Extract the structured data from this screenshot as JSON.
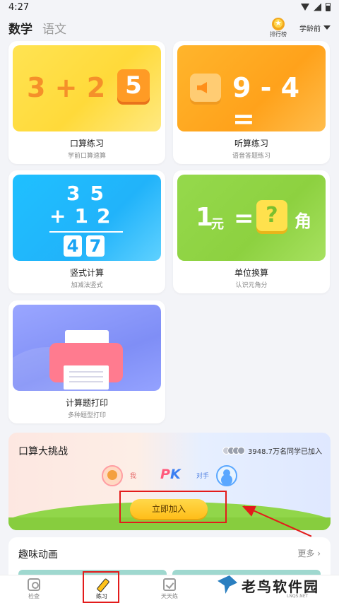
{
  "status_bar": {
    "time": "4:27"
  },
  "header": {
    "tabs": [
      {
        "label": "数学",
        "active": true
      },
      {
        "label": "语文",
        "active": false
      }
    ],
    "rank_label": "排行榜",
    "grade_label": "学龄前"
  },
  "cards": [
    {
      "id": "mental",
      "title": "口算练习",
      "subtitle": "学前口算速算",
      "art_text": "3 + 2 = 5"
    },
    {
      "id": "listen",
      "title": "听算练习",
      "subtitle": "语音答题练习",
      "art_text": "9 - 4 ="
    },
    {
      "id": "vertical",
      "title": "竖式计算",
      "subtitle": "加减法竖式",
      "art_lines": [
        "3 5",
        "+ 1 2",
        "4 7"
      ]
    },
    {
      "id": "unit",
      "title": "单位换算",
      "subtitle": "认识元角分",
      "art_text": {
        "num": "1",
        "yuan": "元",
        "eq": "=",
        "q": "?",
        "jiao": "角"
      }
    },
    {
      "id": "print",
      "title": "计算题打印",
      "subtitle": "多种题型打印"
    }
  ],
  "challenge": {
    "title": "口算大挑战",
    "count_text": "3948.7万名同学已加入",
    "me_label": "我",
    "pk_p": "P",
    "pk_k": "K",
    "opponent_label": "对手",
    "join_button": "立即加入"
  },
  "animations": {
    "title": "趣味动画",
    "more": "更多 ›"
  },
  "bottom_nav": [
    {
      "label": "检查",
      "icon": "camera-icon"
    },
    {
      "label": "练习",
      "icon": "pencil-icon",
      "active": true
    },
    {
      "label": "天天练",
      "icon": "check-calendar-icon"
    }
  ],
  "watermark": {
    "text": "老鸟软件园",
    "sub": "LNQS.NET"
  },
  "colors": {
    "accent_red": "#e31b1b",
    "yellow_card": "#ffde46",
    "orange_card": "#ffa81f",
    "blue_card": "#1fbaff",
    "green_card": "#8dd140",
    "purple_card": "#8693fb",
    "join_button": "#ffc72a"
  }
}
